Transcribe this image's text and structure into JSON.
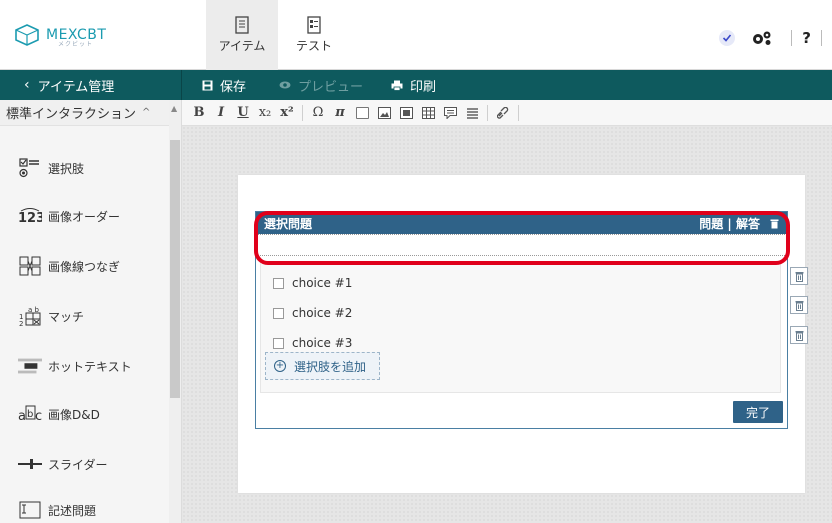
{
  "header": {
    "logo": {
      "text": "MEXCBT",
      "sub": "メクビット"
    },
    "tabs": [
      {
        "label": "アイテム",
        "icon": "document-icon",
        "active": true
      },
      {
        "label": "テスト",
        "icon": "document-list-icon",
        "active": false
      }
    ],
    "right": {
      "help": "?"
    }
  },
  "toolbar": {
    "back_label": "アイテム管理",
    "save_label": "保存",
    "preview_label": "プレビュー",
    "print_label": "印刷"
  },
  "sidebar": {
    "header": "標準インタラクション",
    "items": [
      {
        "label": "選択肢",
        "icon": "choice-icon"
      },
      {
        "label": "画像オーダー",
        "icon": "order-123-icon"
      },
      {
        "label": "画像線つなぎ",
        "icon": "line-connect-icon"
      },
      {
        "label": "マッチ",
        "icon": "match-icon"
      },
      {
        "label": "ホットテキスト",
        "icon": "hottext-icon"
      },
      {
        "label": "画像D&D",
        "icon": "image-dnd-icon"
      },
      {
        "label": "スライダー",
        "icon": "slider-icon"
      },
      {
        "label": "記述問題",
        "icon": "text-entry-icon"
      }
    ]
  },
  "editor_toolbar": {
    "buttons": [
      "B",
      "I",
      "U",
      "x₂",
      "x²",
      "Ω",
      "π"
    ]
  },
  "question": {
    "title": "選択問題",
    "header_right": "問題 | 解答",
    "choices": [
      "choice #1",
      "choice #2",
      "choice #3"
    ],
    "add_label": "選択肢を追加",
    "done_label": "完了"
  },
  "colors": {
    "accent": "#0e5a5e",
    "question_header": "#2f6288",
    "highlight": "#e0001b",
    "brand": "#1b9bb0"
  }
}
